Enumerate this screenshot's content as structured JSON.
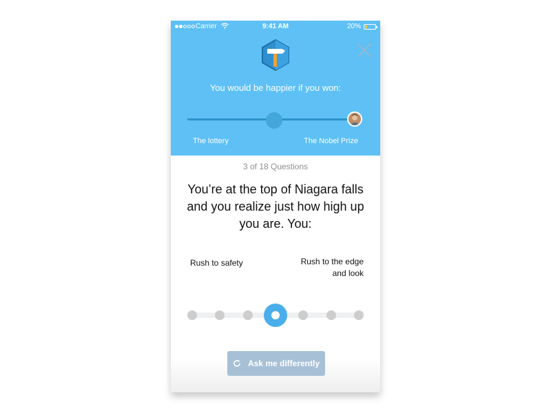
{
  "status_bar": {
    "carrier": "Carrier",
    "time": "9:41 AM",
    "battery": "20%",
    "battery_level": 0.2,
    "signal_bars": 5,
    "signal_filled": 2
  },
  "header": {
    "logo_icon": "hammer-hexagon-icon",
    "close_icon": "close-icon",
    "prompt": "You would be happier if you won:",
    "slider": {
      "left_label": "The lottery",
      "right_label": "The Nobel Prize",
      "value": 0.5
    },
    "avatar_icon": "user-avatar"
  },
  "question": {
    "counter": "3 of 18 Questions",
    "text": "You’re at the top of Niagara falls and you realize just how high up you are. You:",
    "option_left": "Rush to safety",
    "option_right": "Rush to the edge and look",
    "scale_points": 7,
    "selected_index": 3
  },
  "action": {
    "ask_label": "Ask me differently",
    "icon": "refresh-icon"
  },
  "colors": {
    "header_bg": "#5ec0f5",
    "accent": "#4aaeea",
    "button_bg": "#a8c0d6",
    "dot_inactive": "#cdcdcd"
  }
}
